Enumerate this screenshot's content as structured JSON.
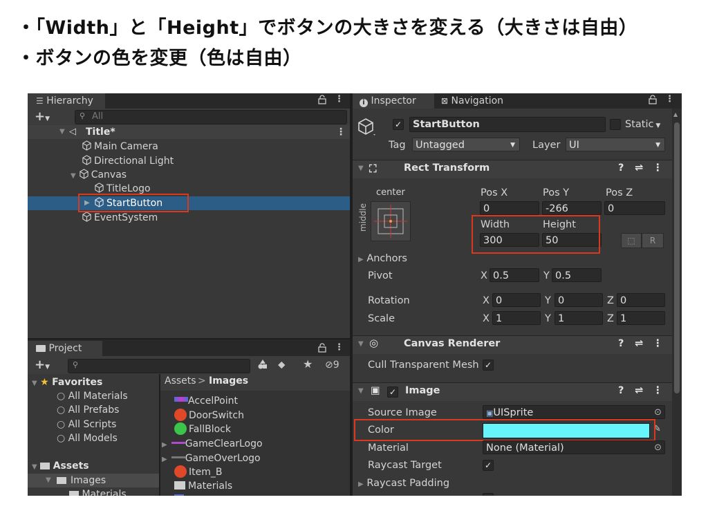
{
  "slide": {
    "line1": "・「Width」と「Height」でボタンの大きさを変える（大きさは自由）",
    "line2": "・ボタンの色を変更（色は自由）"
  },
  "hierarchy": {
    "tab": "Hierarchy",
    "search_placeholder": "All",
    "items": [
      {
        "label": "Title*"
      },
      {
        "label": "Main Camera"
      },
      {
        "label": "Directional Light"
      },
      {
        "label": "Canvas"
      },
      {
        "label": "TitleLogo"
      },
      {
        "label": "StartButton"
      },
      {
        "label": "EventSystem"
      }
    ]
  },
  "project": {
    "tab": "Project",
    "hidden_count": "9",
    "breadcrumb_root": "Assets",
    "breadcrumb_current": "Images",
    "tree": {
      "favorites": "Favorites",
      "fav_items": [
        "All Materials",
        "All Prefabs",
        "All Scripts",
        "All Models"
      ],
      "assets": "Assets",
      "images": "Images",
      "materials": "Materials"
    },
    "files": [
      "AccelPoint",
      "DoorSwitch",
      "FallBlock",
      "GameClearLogo",
      "GameOverLogo",
      "Item_B",
      "Materials"
    ]
  },
  "inspector": {
    "tab": "Inspector",
    "tab2": "Navigation",
    "object_name": "StartButton",
    "static_label": "Static",
    "tag_label": "Tag",
    "tag_value": "Untagged",
    "layer_label": "Layer",
    "layer_value": "UI",
    "rect_transform": {
      "title": "Rect Transform",
      "anchor_h": "center",
      "anchor_v": "middle",
      "pos_x_label": "Pos X",
      "pos_y_label": "Pos Y",
      "pos_z_label": "Pos Z",
      "pos_x": "0",
      "pos_y": "-266",
      "pos_z": "0",
      "width_label": "Width",
      "height_label": "Height",
      "width": "300",
      "height": "50",
      "r_button": "R",
      "anchors_label": "Anchors",
      "pivot_label": "Pivot",
      "pivot_x": "0.5",
      "pivot_y": "0.5",
      "rotation_label": "Rotation",
      "rot_x": "0",
      "rot_y": "0",
      "rot_z": "0",
      "scale_label": "Scale",
      "scale_x": "1",
      "scale_y": "1",
      "scale_z": "1",
      "x": "X",
      "y": "Y",
      "z": "Z"
    },
    "canvas_renderer": {
      "title": "Canvas Renderer",
      "cull_label": "Cull Transparent Mesh"
    },
    "image": {
      "title": "Image",
      "source_label": "Source Image",
      "source_value": "UISprite",
      "color_label": "Color",
      "color_value": "#66f5fb",
      "material_label": "Material",
      "material_value": "None (Material)",
      "raycast_target_label": "Raycast Target",
      "raycast_padding_label": "Raycast Padding"
    }
  },
  "colors": {
    "highlight": "#d8391f",
    "selection": "#2c5d87"
  }
}
